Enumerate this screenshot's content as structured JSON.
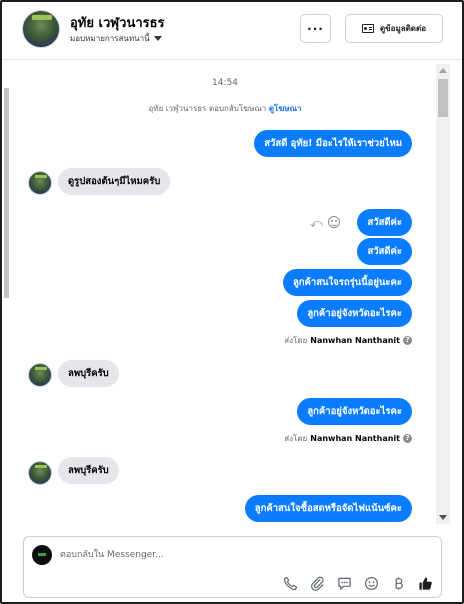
{
  "header": {
    "contact_name": "อุทัย เวฬุวนารธร",
    "assign_label": "มอบหมายการสนทนานี้",
    "more_label": "···",
    "contact_info_label": "ดูข้อมูลติดต่อ"
  },
  "conversation": {
    "timestamp": "14:54",
    "ad_notice_prefix": "อุทัย เวฬุวนารธร ตอบกลับโฆษณา",
    "ad_notice_link": "ดูโฆษณา",
    "messages": [
      {
        "dir": "out",
        "text": "สวัสดี อุทัย! มีอะไรให้เราช่วยไหม"
      },
      {
        "dir": "in",
        "text": "ดูรูปสองต้นๆมีไหมครับ"
      },
      {
        "dir": "out",
        "text": "สวัสดีค่ะ"
      },
      {
        "dir": "out",
        "text": "สวัสดีค่ะ"
      },
      {
        "dir": "out",
        "text": "ลูกค้าสนใจรถรุ่นนี้อยู่นะคะ"
      },
      {
        "dir": "out",
        "text": "ลูกค้าอยู่จังหวัดอะไรคะ"
      },
      {
        "dir": "in",
        "text": "ลพบุรีครับ"
      },
      {
        "dir": "out",
        "text": "ลูกค้าอยู่จังหวัดอะไรคะ"
      },
      {
        "dir": "in",
        "text": "ลพบุรีครับ"
      },
      {
        "dir": "out",
        "text": "ลูกค้าสนใจซื้อสดหรือจัดไฟแน้นซ์คะ"
      }
    ],
    "sent_by_prefix": "ส่งโดย",
    "sent_by_name": "Nanwhan Nanthanit",
    "info_glyph": "?"
  },
  "composer": {
    "placeholder": "ตอบกลับใน Messenger..."
  },
  "icons": [
    "phone-icon",
    "attachment-icon",
    "saved-reply-icon",
    "emoji-icon",
    "payment-icon",
    "like-icon"
  ],
  "colors": {
    "outgoing_bubble": "#0a7cff",
    "incoming_bubble": "#e4e6eb",
    "link": "#1877f2"
  }
}
